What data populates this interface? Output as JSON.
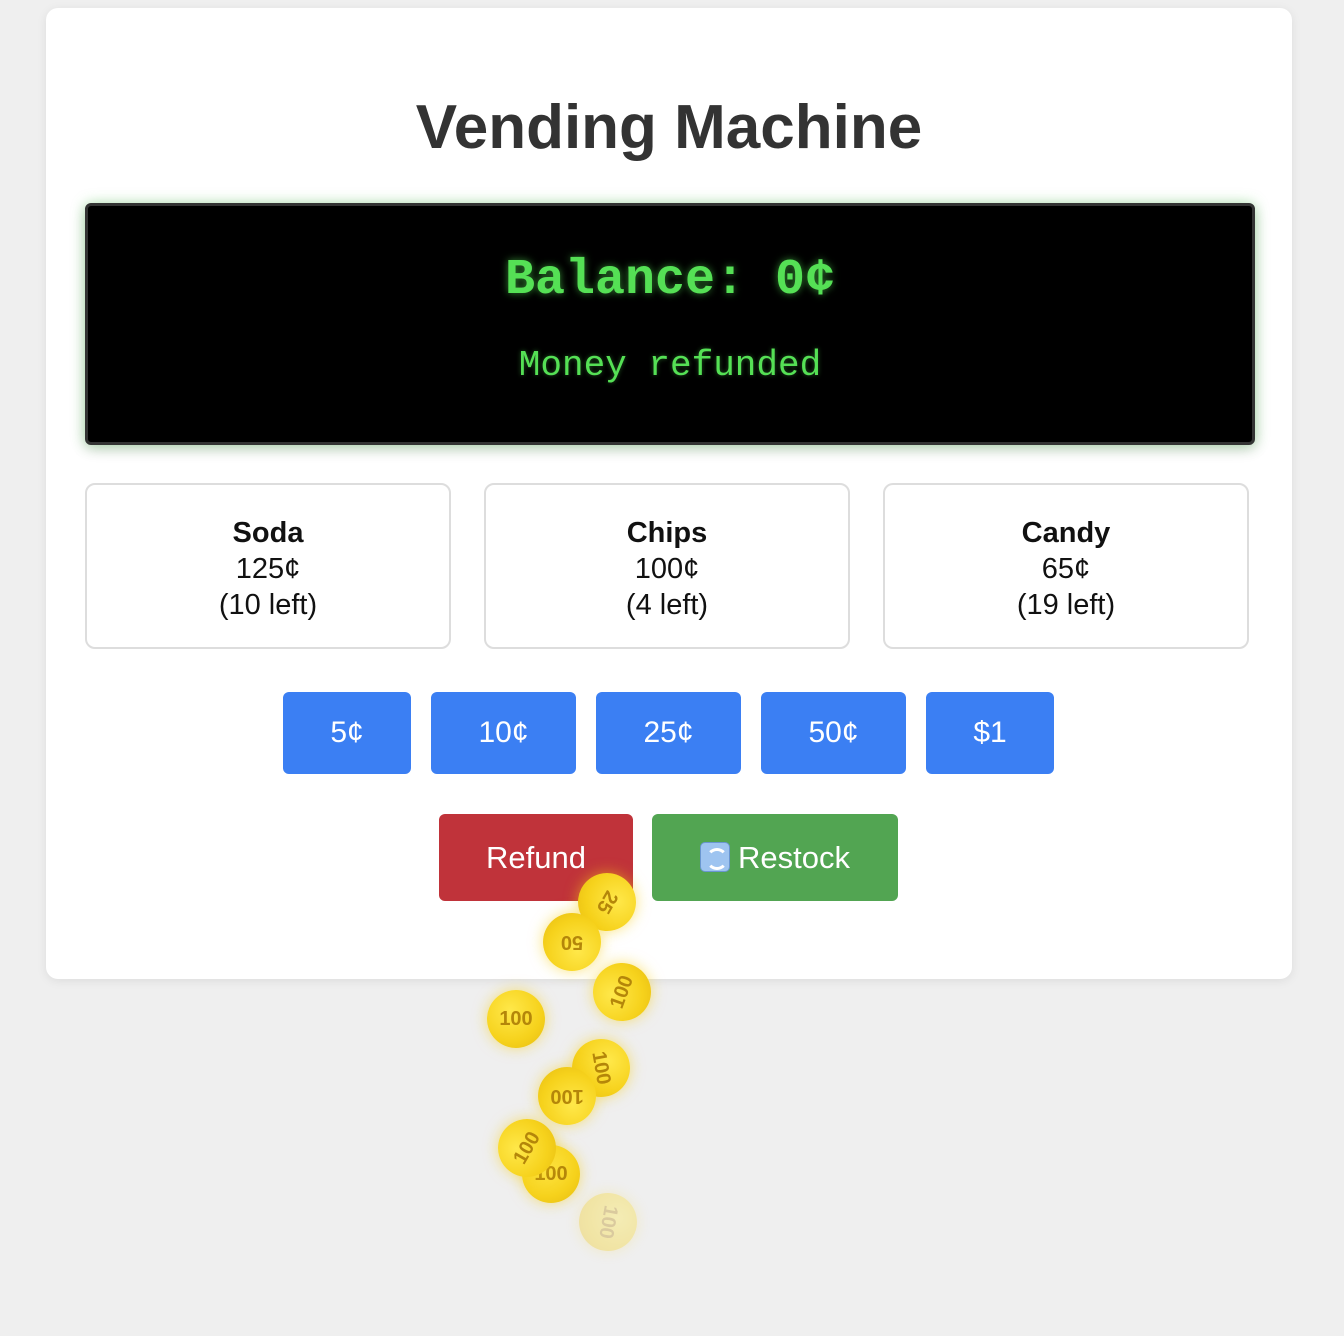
{
  "app": {
    "title": "Vending Machine"
  },
  "display": {
    "balance_text": "Balance: 0¢",
    "message": "Money refunded"
  },
  "products": [
    {
      "name": "Soda",
      "price": "125¢",
      "stock": "(10 left)"
    },
    {
      "name": "Chips",
      "price": "100¢",
      "stock": "(4 left)"
    },
    {
      "name": "Candy",
      "price": "65¢",
      "stock": "(19 left)"
    }
  ],
  "coins": [
    {
      "label": "5¢"
    },
    {
      "label": "10¢"
    },
    {
      "label": "25¢"
    },
    {
      "label": "50¢"
    },
    {
      "label": "$1"
    }
  ],
  "actions": {
    "refund_label": "Refund",
    "restock_label": "Restock",
    "restock_icon": "refresh-icon"
  },
  "falling_coins": [
    {
      "label": "25",
      "rotation": 120,
      "opacity": 1
    },
    {
      "label": "50",
      "rotation": 180,
      "opacity": 1
    },
    {
      "label": "100",
      "rotation": -70,
      "opacity": 1
    },
    {
      "label": "100",
      "rotation": 0,
      "opacity": 1
    },
    {
      "label": "100",
      "rotation": 80,
      "opacity": 1
    },
    {
      "label": "100",
      "rotation": 180,
      "opacity": 1
    },
    {
      "label": "100",
      "rotation": 0,
      "opacity": 1
    },
    {
      "label": "100",
      "rotation": -60,
      "opacity": 1
    },
    {
      "label": "100",
      "rotation": 100,
      "opacity": 0.35
    }
  ],
  "colors": {
    "background": "#efefef",
    "card": "#ffffff",
    "display_bg": "#000000",
    "display_text": "#55e055",
    "coin_button": "#3b7ff3",
    "refund": "#c0333a",
    "restock": "#52a552",
    "coin_gold": "#f6d21c"
  }
}
